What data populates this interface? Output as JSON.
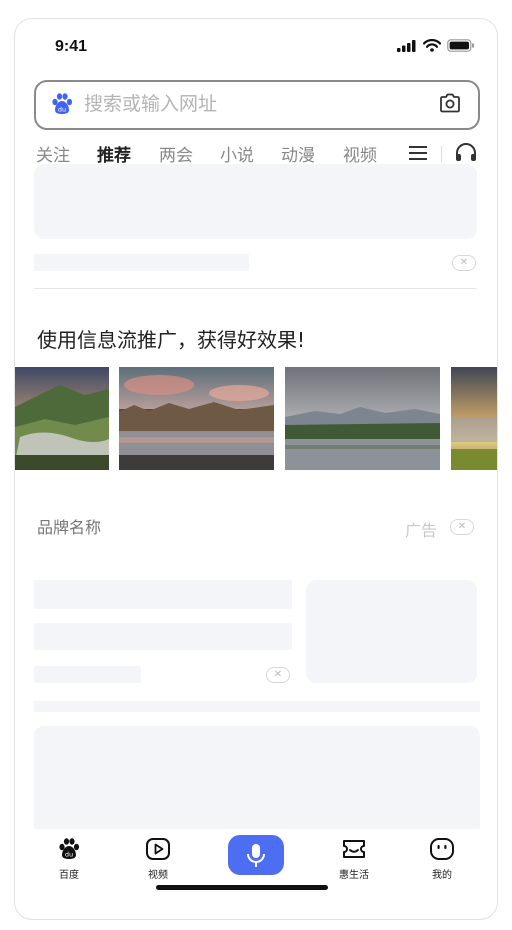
{
  "status_bar": {
    "time": "9:41"
  },
  "search": {
    "placeholder": "搜索或输入网址"
  },
  "tabs": [
    {
      "label": "关注"
    },
    {
      "label": "推荐",
      "active": true
    },
    {
      "label": "两会"
    },
    {
      "label": "小说"
    },
    {
      "label": "动漫"
    },
    {
      "label": "视频"
    }
  ],
  "ad_card": {
    "headline": "使用信息流推广，获得好效果!"
  },
  "brand_card": {
    "brand_name": "品牌名称",
    "ad_label": "广告"
  },
  "bottom_nav": [
    {
      "label": "百度",
      "icon": "baidu-paw-icon"
    },
    {
      "label": "视频",
      "icon": "video-play-icon"
    },
    {
      "label": "",
      "icon": "microphone-icon"
    },
    {
      "label": "惠生活",
      "icon": "life-icon"
    },
    {
      "label": "我的",
      "icon": "profile-face-icon"
    }
  ],
  "colors": {
    "accent": "#4e6ef2",
    "placeholder": "#f4f5f8",
    "muted_text": "#888888"
  }
}
